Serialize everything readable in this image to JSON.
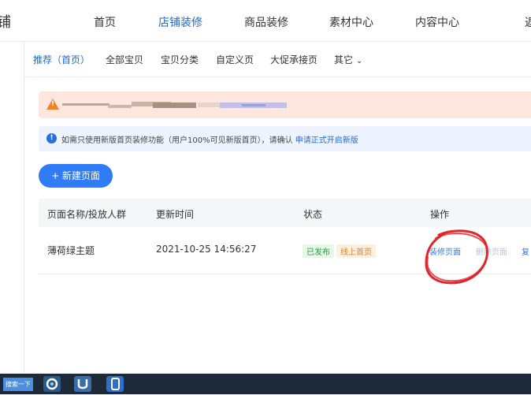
{
  "topnav": {
    "brand_char": "铺",
    "items": [
      {
        "label": "首页",
        "active": false
      },
      {
        "label": "店铺装修",
        "active": true
      },
      {
        "label": "商品装修",
        "active": false
      },
      {
        "label": "素材中心",
        "active": false
      },
      {
        "label": "内容中心",
        "active": false
      },
      {
        "label": "返",
        "active": false
      }
    ]
  },
  "subnav": {
    "items": [
      {
        "label": "推荐（首页）",
        "active": true
      },
      {
        "label": "全部宝贝"
      },
      {
        "label": "宝贝分类"
      },
      {
        "label": "自定义页"
      },
      {
        "label": "大促承接页"
      },
      {
        "label": "其它"
      }
    ]
  },
  "info_banner": {
    "text": "如需只使用新版首页装修功能（用户100%可见新版首页），请确认",
    "link": "申请正式开启新版"
  },
  "new_page_button": "+ 新建页面",
  "table": {
    "headers": [
      "页面名称/投放人群",
      "更新时间",
      "状态",
      "操作"
    ],
    "rows": [
      {
        "name": "薄荷绿主题",
        "updated": "2021-10-25 14:56:27",
        "tags": [
          "已发布",
          "线上首页"
        ],
        "actions": [
          "装修页面",
          "删除页面",
          "复"
        ]
      }
    ]
  },
  "taskbar": {
    "search_label": "搜索一下"
  },
  "colors": {
    "accent": "#1f6bd6",
    "button": "#2f7cf6",
    "warn_bg": "#fde7df",
    "info_bg": "#eef4ff",
    "annotation": "#e0262a"
  }
}
